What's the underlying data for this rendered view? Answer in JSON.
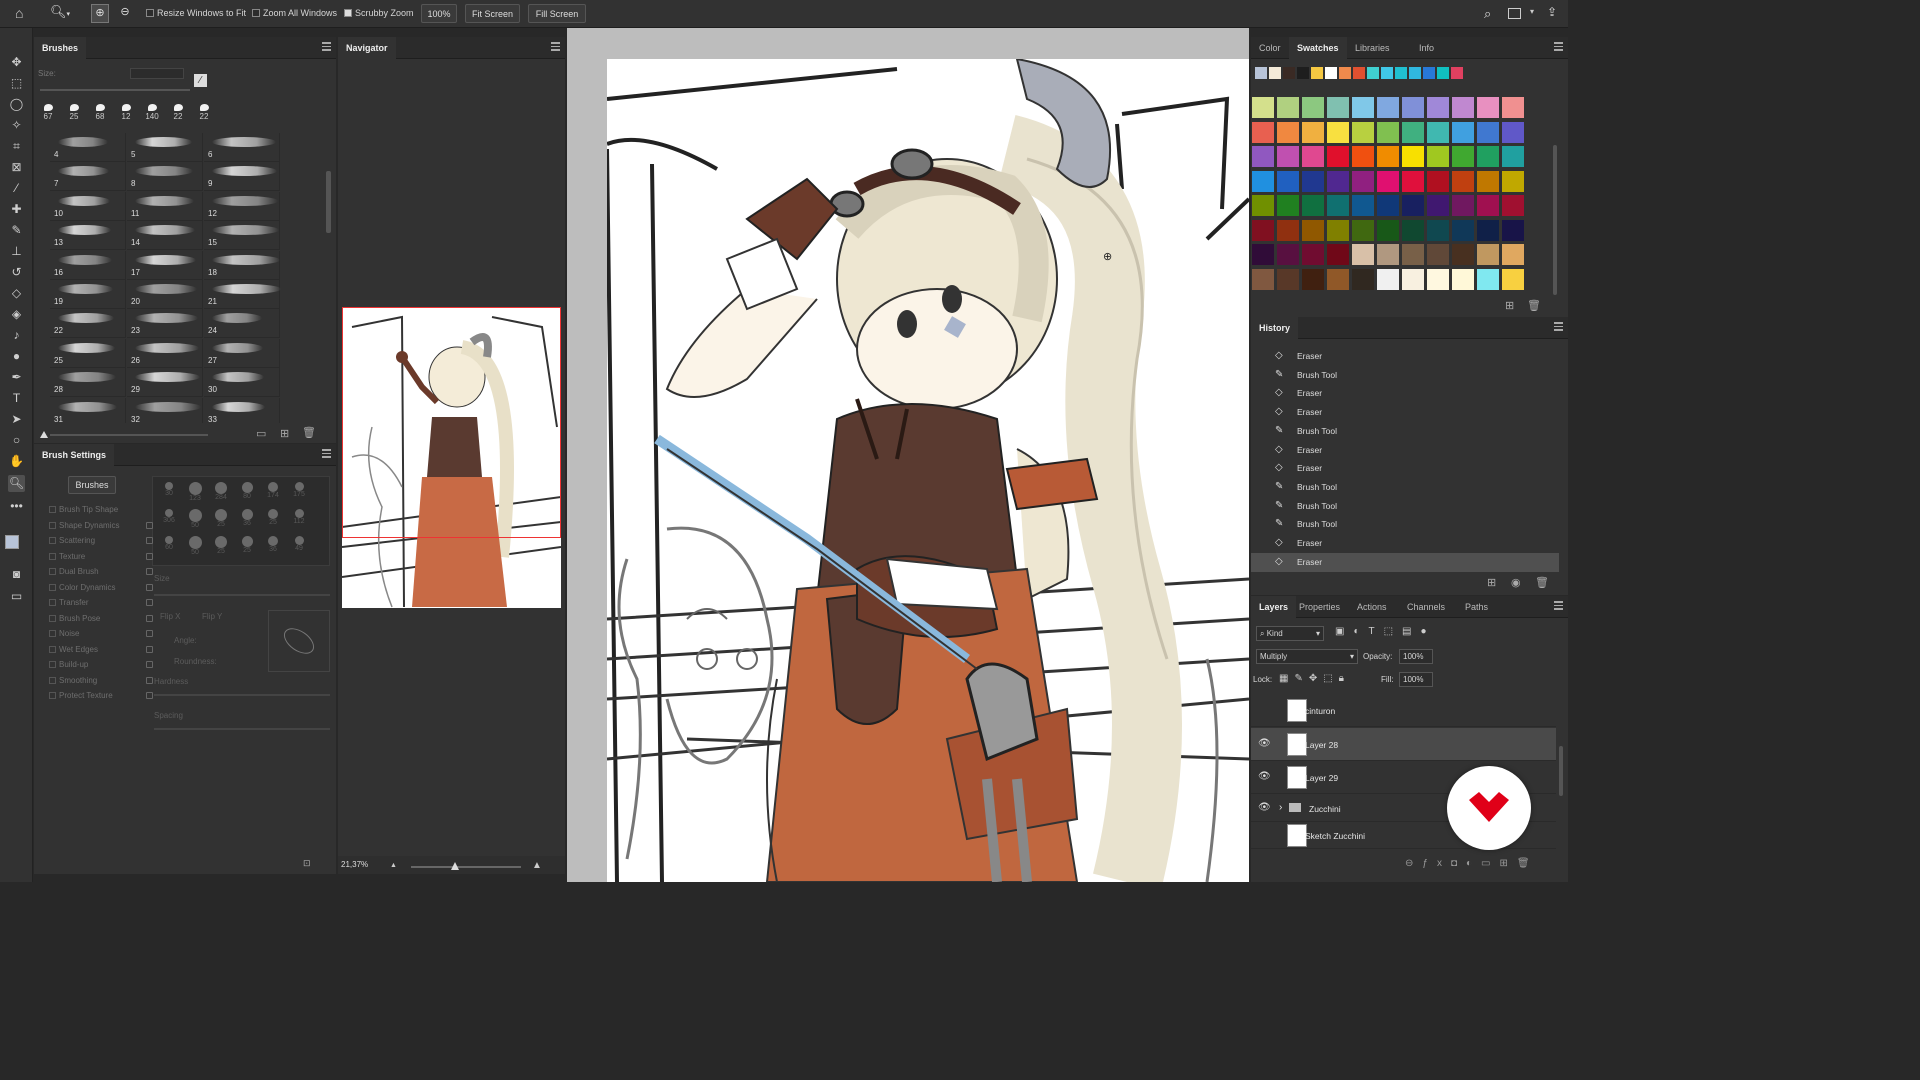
{
  "options_bar": {
    "resize_windows": "Resize Windows to Fit",
    "zoom_all": "Zoom All Windows",
    "scrubby": "Scrubby Zoom",
    "zoom_percent": "100%",
    "fit_screen": "Fit Screen",
    "fill_screen": "Fill Screen",
    "resize_checked": false,
    "zoom_all_checked": false,
    "scrubby_checked": true
  },
  "brushes_panel": {
    "title": "Brushes",
    "size_label": "Size:",
    "tips": [
      "67",
      "25",
      "68",
      "12",
      "140",
      "22",
      "22"
    ],
    "presets": [
      "4",
      "5",
      "6",
      "7",
      "8",
      "9",
      "10",
      "11",
      "12",
      "13",
      "14",
      "15",
      "16",
      "17",
      "18",
      "19",
      "20",
      "21",
      "22",
      "23",
      "24",
      "25",
      "26",
      "27",
      "28",
      "29",
      "30",
      "31",
      "32",
      "33"
    ]
  },
  "navigator": {
    "title": "Navigator",
    "zoom": "21,37%"
  },
  "brush_settings": {
    "title": "Brush Settings",
    "brushes_button": "Brushes",
    "options": [
      "Brush Tip Shape",
      "Shape Dynamics",
      "Scattering",
      "Texture",
      "Dual Brush",
      "Color Dynamics",
      "Transfer",
      "Brush Pose",
      "Noise",
      "Wet Edges",
      "Build-up",
      "Smoothing",
      "Protect Texture"
    ],
    "tip_numbers": [
      "30",
      "123",
      "284",
      "80",
      "174",
      "175",
      "306",
      "50",
      "25",
      "36",
      "25",
      "112",
      "60",
      "50",
      "25",
      "25",
      "36",
      "49"
    ],
    "size": "Size",
    "flip_x": "Flip X",
    "flip_y": "Flip Y",
    "angle": "Angle:",
    "roundness": "Roundness:",
    "hardness": "Hardness",
    "spacing": "Spacing"
  },
  "color_panel": {
    "tabs": [
      "Color",
      "Swatches",
      "Libraries",
      "Info"
    ],
    "active": "Swatches",
    "recent": [
      "#b8c4d8",
      "#f4ead8",
      "#3a2a24",
      "#1e1e1e",
      "#f5c842",
      "#ffffff",
      "#f08a4c",
      "#e05030",
      "#40d0d0",
      "#40c8e8",
      "#20c0d0",
      "#30b8e0",
      "#2878d8",
      "#10c0c0",
      "#e04060"
    ],
    "rows": [
      [
        "#d4e08c",
        "#b0d080",
        "#8cc880",
        "#80c0b0",
        "#80c8e8",
        "#80a8e0",
        "#8090d8",
        "#a088d8",
        "#c088d0",
        "#e890c0",
        "#f09090"
      ],
      [
        "#e86050",
        "#f08840",
        "#f0b040",
        "#f8e040",
        "#b8d040",
        "#80c050",
        "#40b080",
        "#40b8b0",
        "#40a0e0",
        "#4078d0",
        "#6058c8"
      ],
      [
        "#9058c0",
        "#c050b0",
        "#e04890",
        "#e0102c",
        "#f05010",
        "#f08c00",
        "#f8e000",
        "#a0c820",
        "#40a830",
        "#20a060",
        "#20a0a0"
      ],
      [
        "#2090e0",
        "#2060c0",
        "#203890",
        "#502890",
        "#902080",
        "#e01070",
        "#e0103c",
        "#b01020",
        "#c04010",
        "#c07800",
        "#c0a800"
      ],
      [
        "#709000",
        "#208020",
        "#107040",
        "#107070",
        "#105890",
        "#103878",
        "#182060",
        "#401870",
        "#701860",
        "#a01050",
        "#a01030"
      ],
      [
        "#801020",
        "#903010",
        "#905800",
        "#808000",
        "#406810",
        "#185818",
        "#104830",
        "#104850",
        "#103858",
        "#102048",
        "#181448"
      ],
      [
        "#300c38",
        "#581040",
        "#700c30",
        "#700818",
        "#d8c0a8",
        "#b09880",
        "#786048",
        "#604838",
        "#483020",
        "#c09860",
        "#e0a860"
      ],
      [
        "#805840",
        "#583828",
        "#402010",
        "#905828",
        "#302820",
        "#f0f0f0",
        "#f8f0e0",
        "#fff8e0",
        "#fff8d8",
        "#80e8f0",
        "#f8d040"
      ]
    ]
  },
  "history": {
    "title": "History",
    "items": [
      "Eraser",
      "Brush Tool",
      "Eraser",
      "Eraser",
      "Brush Tool",
      "Eraser",
      "Eraser",
      "Brush Tool",
      "Brush Tool",
      "Brush Tool",
      "Eraser",
      "Eraser"
    ]
  },
  "layers": {
    "tabs": [
      "Layers",
      "Properties",
      "Actions",
      "Channels",
      "Paths"
    ],
    "active": "Layers",
    "kind": "Kind",
    "blend": "Multiply",
    "opacity_label": "Opacity:",
    "opacity": "100%",
    "lock_label": "Lock:",
    "fill_label": "Fill:",
    "fill": "100%",
    "rows": [
      {
        "name": "cinturon",
        "visible": false
      },
      {
        "name": "Layer 28",
        "visible": true
      },
      {
        "name": "Layer 29",
        "visible": true
      },
      {
        "name": "Zucchini",
        "visible": true
      },
      {
        "name": "Sketch Zucchini",
        "visible": false
      }
    ]
  }
}
